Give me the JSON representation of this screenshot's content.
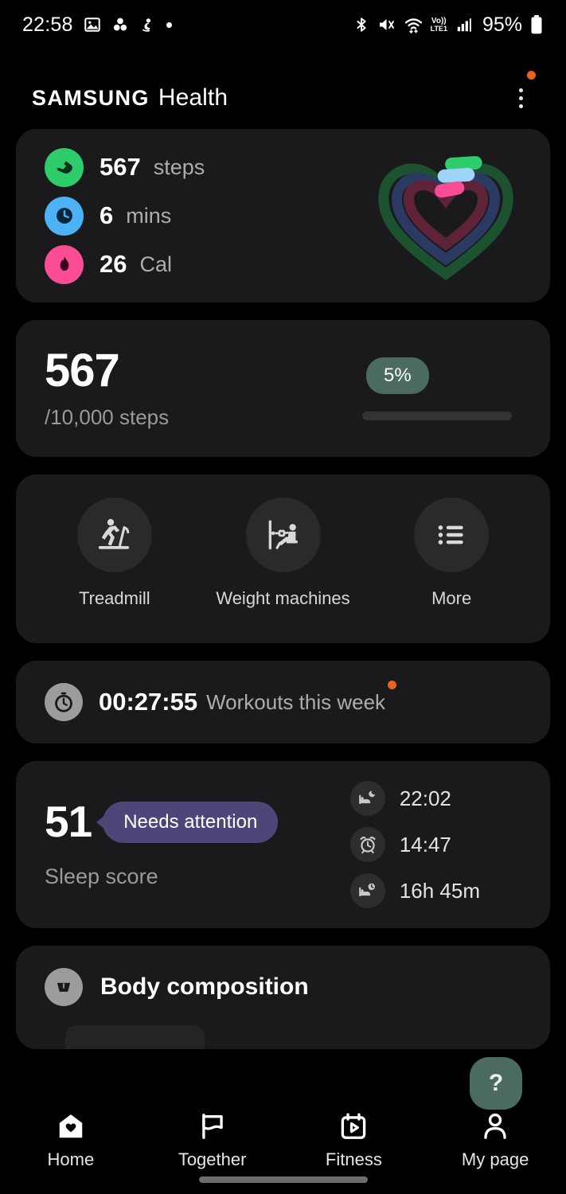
{
  "status_bar": {
    "time": "22:58",
    "battery_text": "95%",
    "volte_top": "Vo))",
    "volte_bottom": "LTE1",
    "left_icons": [
      "gallery-icon",
      "dots-cluster-icon",
      "figure-icon",
      "dot-icon"
    ],
    "right_icons": [
      "bluetooth-icon",
      "mute-vibrate-icon",
      "wifi-icon",
      "volte-icon",
      "signal-icon",
      "battery-icon"
    ]
  },
  "header": {
    "brand_samsung": "SAMSUNG",
    "brand_health": "Health",
    "menu_icon": "more-vertical-icon",
    "badge_color": "#e8641e"
  },
  "activity_card": {
    "rows": [
      {
        "icon": "shoe-icon",
        "value": "567",
        "unit": "steps",
        "color": "#2ecc6a"
      },
      {
        "icon": "clock-icon",
        "value": "6",
        "unit": "mins",
        "color": "#4db1f5"
      },
      {
        "icon": "flame-icon",
        "value": "26",
        "unit": "Cal",
        "color": "#fa4d96"
      }
    ],
    "ring_graphic": "heart-activity-rings"
  },
  "steps_card": {
    "value": "567",
    "goal_text": "/10,000 steps",
    "percent_label": "5%",
    "percent_value": 5,
    "pill_color": "#4b6b5e",
    "bar_color": "#18d46c"
  },
  "shortcuts_card": {
    "items": [
      {
        "icon": "treadmill-icon",
        "label": "Treadmill"
      },
      {
        "icon": "weight-machine-icon",
        "label": "Weight machines"
      },
      {
        "icon": "list-icon",
        "label": "More"
      }
    ]
  },
  "workout_card": {
    "icon": "stopwatch-icon",
    "duration": "00:27:55",
    "label": "Workouts this week",
    "badge_color": "#e8641e"
  },
  "sleep_card": {
    "score": "51",
    "badge": "Needs attention",
    "badge_color": "#4d4779",
    "label": "Sleep score",
    "details": [
      {
        "icon": "bed-moon-icon",
        "value": "22:02"
      },
      {
        "icon": "alarm-clock-icon",
        "value": "14:47"
      },
      {
        "icon": "bed-clock-icon",
        "value": "16h 45m"
      }
    ]
  },
  "body_card": {
    "icon": "scale-icon",
    "title": "Body composition"
  },
  "fab": {
    "label": "?",
    "icon": "help-icon",
    "color": "#4b6b5e"
  },
  "bottom_nav": {
    "items": [
      {
        "icon": "home-heart-icon",
        "label": "Home",
        "active": true
      },
      {
        "icon": "flag-icon",
        "label": "Together",
        "active": false
      },
      {
        "icon": "calendar-play-icon",
        "label": "Fitness",
        "active": false
      },
      {
        "icon": "person-icon",
        "label": "My page",
        "active": false
      }
    ]
  }
}
